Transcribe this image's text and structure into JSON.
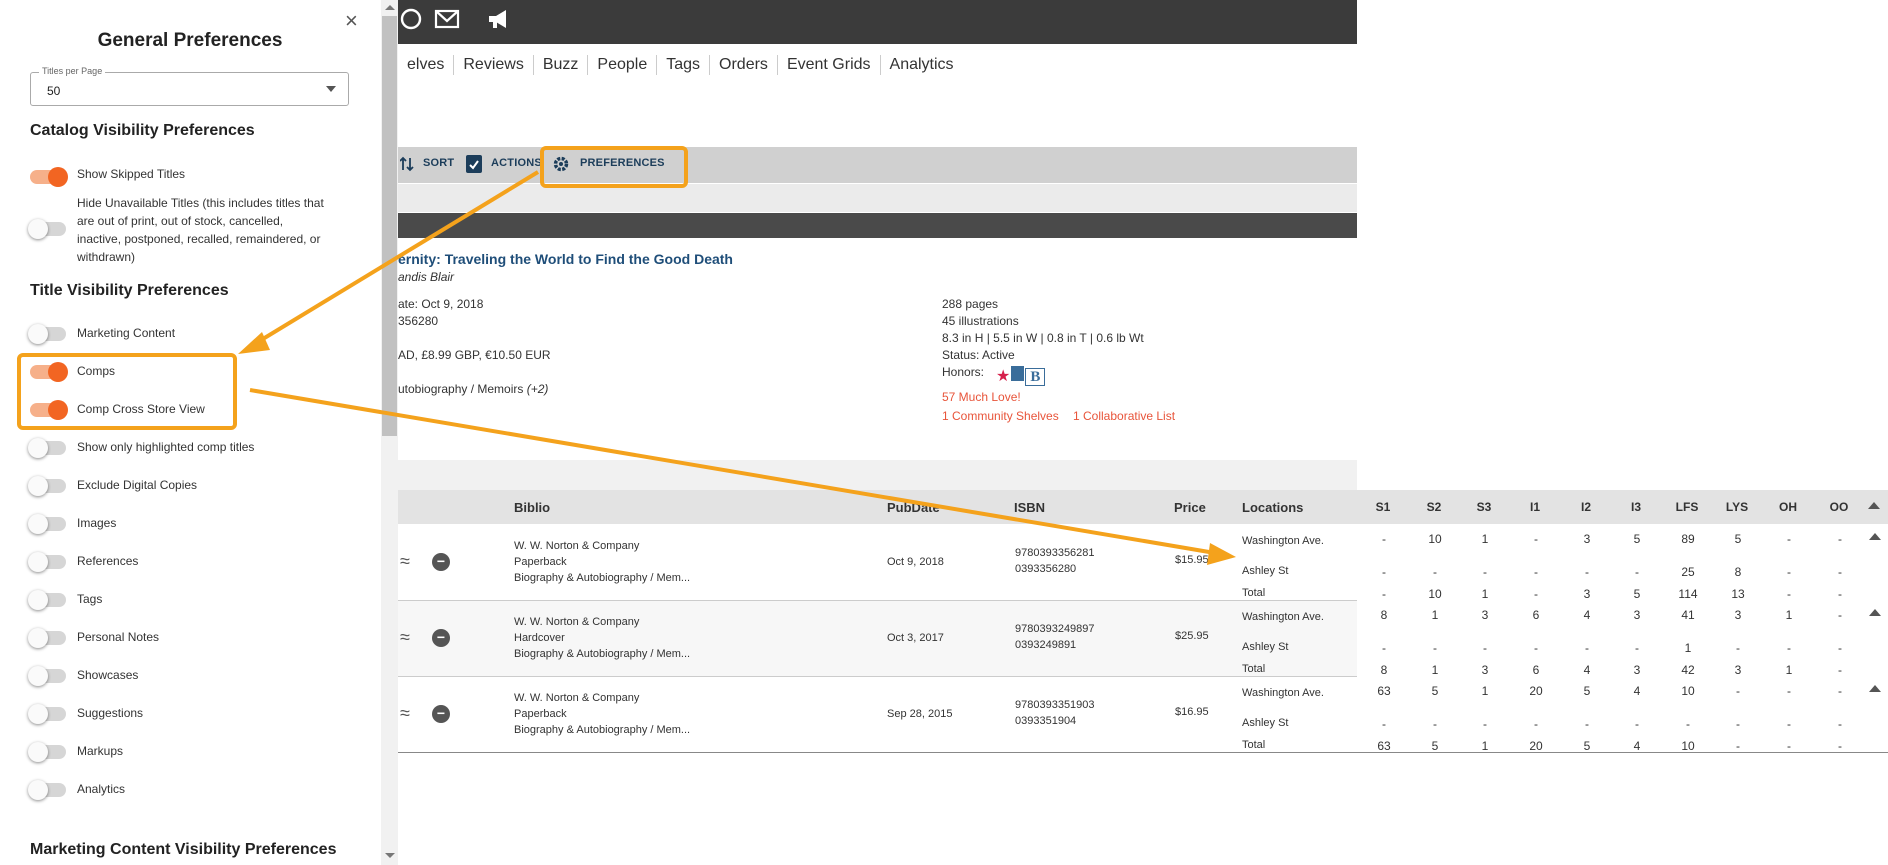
{
  "panel": {
    "title": "General Preferences",
    "close": "×",
    "titles_per_page": {
      "label": "Titles per Page",
      "value": "50"
    },
    "catalog_section": "Catalog Visibility Preferences",
    "catalog_toggles": [
      {
        "label": "Show Skipped Titles",
        "on": true
      },
      {
        "label": "Hide Unavailable Titles (this includes titles that are out of print, out of stock, cancelled, inactive, postponed, recalled, remaindered, or withdrawn)",
        "on": false
      }
    ],
    "title_section": "Title Visibility Preferences",
    "title_toggles": [
      {
        "label": "Marketing Content",
        "on": false
      },
      {
        "label": "Comps",
        "on": true
      },
      {
        "label": "Comp Cross Store View",
        "on": true
      },
      {
        "label": "Show only highlighted comp titles",
        "on": false
      },
      {
        "label": "Exclude Digital Copies",
        "on": false
      },
      {
        "label": "Images",
        "on": false
      },
      {
        "label": "References",
        "on": false
      },
      {
        "label": "Tags",
        "on": false
      },
      {
        "label": "Personal Notes",
        "on": false
      },
      {
        "label": "Showcases",
        "on": false
      },
      {
        "label": "Suggestions",
        "on": false
      },
      {
        "label": "Markups",
        "on": false
      },
      {
        "label": "Analytics",
        "on": false
      }
    ],
    "marketing_section": "Marketing Content Visibility Preferences"
  },
  "nav": [
    "elves",
    "Reviews",
    "Buzz",
    "People",
    "Tags",
    "Orders",
    "Event Grids",
    "Analytics"
  ],
  "toolbar": {
    "sort": "SORT",
    "actions": "ACTIONS",
    "preferences": "PREFERENCES"
  },
  "book": {
    "title_prefix": "ernity:",
    "title": "Traveling the World to Find the Good Death",
    "author": "andis Blair",
    "pubdate": "ate: Oct 9, 2018",
    "isbn_partial": "356280",
    "price_line": "AD, £8.99 GBP, €10.50 EUR",
    "category_line": "utobiography / Memoirs",
    "category_more": "(+2)",
    "pages": "288 pages",
    "illustrations": "45 illustrations",
    "dimensions": "8.3 in H | 5.5 in W | 0.8 in T | 0.6 lb Wt",
    "status": "Status: Active",
    "honors": "Honors:",
    "love": "57 Much Love!",
    "shelves": "1 Community Shelves",
    "collab": "1 Collaborative List"
  },
  "table": {
    "headers": {
      "biblio": "Biblio",
      "pubdate": "PubDate",
      "isbn": "ISBN",
      "price": "Price",
      "locations": "Locations"
    },
    "store_cols": [
      "S1",
      "S2",
      "S3",
      "I1",
      "I2",
      "I3",
      "LFS",
      "LYS",
      "OH",
      "OO"
    ],
    "rows": [
      {
        "publisher": "W. W. Norton & Company",
        "format": "Paperback",
        "category": "Biography & Autobiography / Mem...",
        "pubdate": "Oct 9, 2018",
        "isbn13": "9780393356281",
        "isbn10": "0393356280",
        "price": "$15.95",
        "locations": [
          {
            "name": "Washington Ave.",
            "values": [
              "-",
              "10",
              "1",
              "-",
              "3",
              "5",
              "89",
              "5",
              "-",
              "-"
            ]
          },
          {
            "name": "Ashley St",
            "values": [
              "-",
              "-",
              "-",
              "-",
              "-",
              "-",
              "25",
              "8",
              "-",
              "-"
            ]
          },
          {
            "name": "Total",
            "values": [
              "-",
              "10",
              "1",
              "-",
              "3",
              "5",
              "114",
              "13",
              "-",
              "-"
            ]
          }
        ]
      },
      {
        "publisher": "W. W. Norton & Company",
        "format": "Hardcover",
        "category": "Biography & Autobiography / Mem...",
        "pubdate": "Oct 3, 2017",
        "isbn13": "9780393249897",
        "isbn10": "0393249891",
        "price": "$25.95",
        "locations": [
          {
            "name": "Washington Ave.",
            "values": [
              "8",
              "1",
              "3",
              "6",
              "4",
              "3",
              "41",
              "3",
              "1",
              "-"
            ]
          },
          {
            "name": "Ashley St",
            "values": [
              "-",
              "-",
              "-",
              "-",
              "-",
              "-",
              "1",
              "-",
              "-",
              "-"
            ]
          },
          {
            "name": "Total",
            "values": [
              "8",
              "1",
              "3",
              "6",
              "4",
              "3",
              "42",
              "3",
              "1",
              "-"
            ]
          }
        ]
      },
      {
        "publisher": "W. W. Norton & Company",
        "format": "Paperback",
        "category": "Biography & Autobiography / Mem...",
        "pubdate": "Sep 28, 2015",
        "isbn13": "9780393351903",
        "isbn10": "0393351904",
        "price": "$16.95",
        "locations": [
          {
            "name": "Washington Ave.",
            "values": [
              "63",
              "5",
              "1",
              "20",
              "5",
              "4",
              "10",
              "-",
              "-",
              "-"
            ]
          },
          {
            "name": "Ashley St",
            "values": [
              "-",
              "-",
              "-",
              "-",
              "-",
              "-",
              "-",
              "-",
              "-",
              "-"
            ]
          },
          {
            "name": "Total",
            "values": [
              "63",
              "5",
              "1",
              "20",
              "5",
              "4",
              "10",
              "-",
              "-",
              "-"
            ]
          }
        ]
      }
    ]
  },
  "colors": {
    "accent": "#f26522",
    "highlight": "#f4a21c",
    "link": "#1f4e79"
  }
}
